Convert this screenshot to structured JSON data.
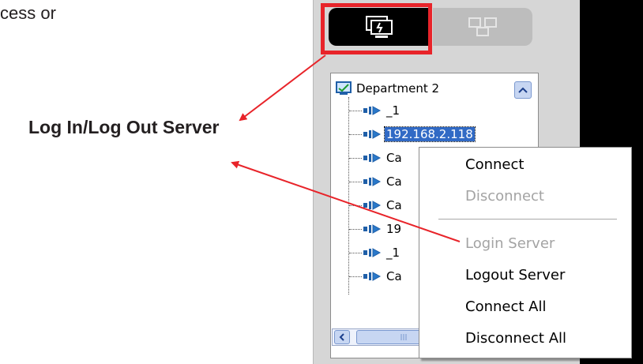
{
  "document": {
    "fragment_text": "cess or",
    "callout_label": "Log In/Log Out Server"
  },
  "tree": {
    "root_label": "Department 2",
    "items": [
      {
        "label": "_1",
        "selected": false
      },
      {
        "label": "192.168.2.118",
        "selected": true
      },
      {
        "label": "Ca",
        "selected": false
      },
      {
        "label": "Ca",
        "selected": false
      },
      {
        "label": "Ca",
        "selected": false
      },
      {
        "label": "19",
        "selected": false
      },
      {
        "label": "_1",
        "selected": false
      },
      {
        "label": "Ca",
        "selected": false
      }
    ]
  },
  "context_menu": {
    "items": [
      {
        "label": "Connect",
        "enabled": true
      },
      {
        "label": "Disconnect",
        "enabled": false
      },
      {
        "label": "Login Server",
        "enabled": false
      },
      {
        "label": "Logout Server",
        "enabled": true
      },
      {
        "label": "Connect All",
        "enabled": true
      },
      {
        "label": "Disconnect All",
        "enabled": true
      }
    ]
  },
  "icons": {
    "active_tab": "server-monitor-icon",
    "inactive_tab": "network-monitors-icon",
    "root": "group-monitor-icon",
    "device": "camera-device-icon"
  },
  "colors": {
    "highlight": "#e8242a",
    "selection": "#316ac5",
    "disabled_text": "#a3a3a3"
  }
}
